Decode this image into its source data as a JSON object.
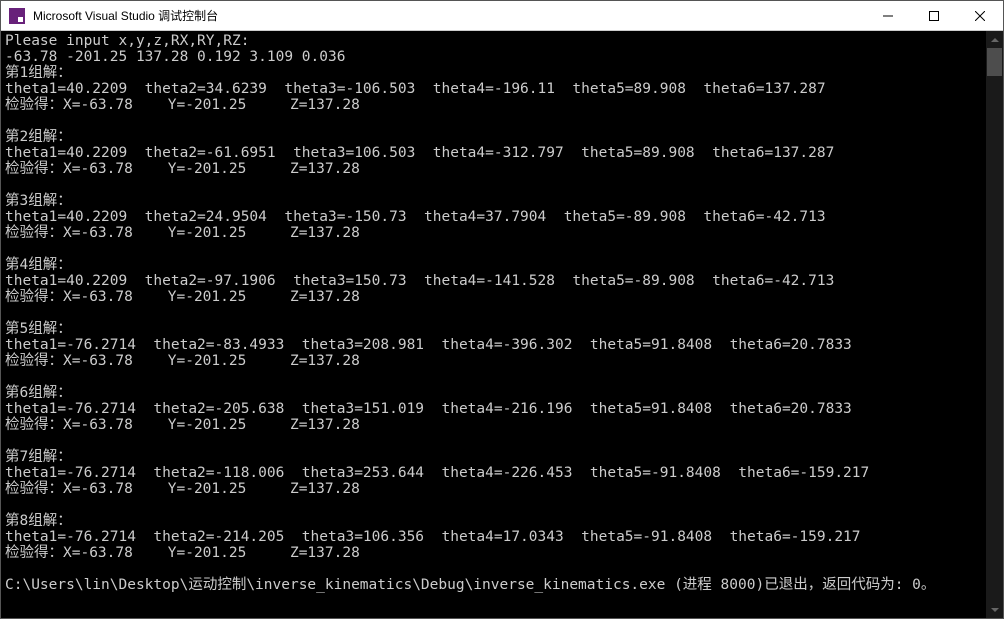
{
  "window": {
    "title": "Microsoft Visual Studio 调试控制台"
  },
  "console": {
    "prompt": "Please input x,y,z,RX,RY,RZ:",
    "input": "-63.78 -201.25 137.28 0.192 3.109 0.036",
    "groups": [
      {
        "label": "第1组解：",
        "theta": "theta1=40.2209  theta2=34.6239  theta3=-106.503  theta4=-196.11  theta5=89.908  theta6=137.287",
        "verify": "检验得：X=-63.78    Y=-201.25     Z=137.28"
      },
      {
        "label": "第2组解：",
        "theta": "theta1=40.2209  theta2=-61.6951  theta3=106.503  theta4=-312.797  theta5=89.908  theta6=137.287",
        "verify": "检验得：X=-63.78    Y=-201.25     Z=137.28"
      },
      {
        "label": "第3组解：",
        "theta": "theta1=40.2209  theta2=24.9504  theta3=-150.73  theta4=37.7904  theta5=-89.908  theta6=-42.713",
        "verify": "检验得：X=-63.78    Y=-201.25     Z=137.28"
      },
      {
        "label": "第4组解：",
        "theta": "theta1=40.2209  theta2=-97.1906  theta3=150.73  theta4=-141.528  theta5=-89.908  theta6=-42.713",
        "verify": "检验得：X=-63.78    Y=-201.25     Z=137.28"
      },
      {
        "label": "第5组解：",
        "theta": "theta1=-76.2714  theta2=-83.4933  theta3=208.981  theta4=-396.302  theta5=91.8408  theta6=20.7833",
        "verify": "检验得：X=-63.78    Y=-201.25     Z=137.28"
      },
      {
        "label": "第6组解：",
        "theta": "theta1=-76.2714  theta2=-205.638  theta3=151.019  theta4=-216.196  theta5=91.8408  theta6=20.7833",
        "verify": "检验得：X=-63.78    Y=-201.25     Z=137.28"
      },
      {
        "label": "第7组解：",
        "theta": "theta1=-76.2714  theta2=-118.006  theta3=253.644  theta4=-226.453  theta5=-91.8408  theta6=-159.217",
        "verify": "检验得：X=-63.78    Y=-201.25     Z=137.28"
      },
      {
        "label": "第8组解：",
        "theta": "theta1=-76.2714  theta2=-214.205  theta3=106.356  theta4=17.0343  theta5=-91.8408  theta6=-159.217",
        "verify": "检验得：X=-63.78    Y=-201.25     Z=137.28"
      }
    ],
    "exit": "C:\\Users\\lin\\Desktop\\运动控制\\inverse_kinematics\\Debug\\inverse_kinematics.exe (进程 8000)已退出，返回代码为: 0。"
  }
}
